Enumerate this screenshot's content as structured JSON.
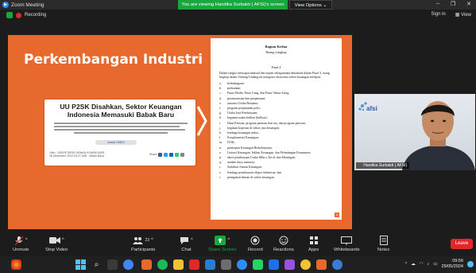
{
  "window": {
    "title": "Zoom Meeting",
    "share_banner": "You are viewing Handika Surbakti ( AFSI)'s screen",
    "view_options": "View Options"
  },
  "header": {
    "recording": "Recording",
    "sign_in": "Sign in",
    "view": "View"
  },
  "slide": {
    "title": "Perkembangan Industri",
    "article": {
      "title_line1": "UU P2SK Disahkan, Sektor Keuangan",
      "title_line2": "Indonesia Memasuki Babak Baru",
      "author_pill": "Sekdir DSBSI",
      "meta_line1": "Oleh : SEKRETARIS DEWAN KOMISIONER",
      "meta_line2": "28 Desember 2022 15:27 WIB · Waktu Baca",
      "share_label": "Share"
    },
    "document": {
      "heading": "Bagian Kedua",
      "subheading": "Ruang Lingkup",
      "article": "Pasal 4",
      "intro": "Dalam rangka mencapai maksud dan tujuan sebagaimana dimaksud dalam Pasal 3, ruang lingkup dalam Undang-Undang ini mengatur ekosistem sektor keuangan meliputi:",
      "items": [
        {
          "l": "a.",
          "t": "kelembagaan;"
        },
        {
          "l": "b.",
          "t": "perbankan;"
        },
        {
          "l": "c.",
          "t": "Pasar Modal, Pasar Uang, dan Pasar Valuta Asing;"
        },
        {
          "l": "d.",
          "t": "perasuransian dan penjaminan;"
        },
        {
          "l": "e.",
          "t": "asuransi Usaha Bersama;"
        },
        {
          "l": "f.",
          "t": "program penjaminan polis;"
        },
        {
          "l": "g.",
          "t": "Usaha Jasa Pembiayaan;"
        },
        {
          "l": "h.",
          "t": "kegiatan usaha bullion (bullion);"
        },
        {
          "l": "i.",
          "t": "Dana Pensiun, program jaminan hari tua, dan program pensiun;"
        },
        {
          "l": "j.",
          "t": "kegiatan koperasi di sektor jasa keuangan;"
        },
        {
          "l": "k.",
          "t": "lembaga keuangan mikro;"
        },
        {
          "l": "l.",
          "t": "Konglomerasi Keuangan;"
        },
        {
          "l": "m.",
          "t": "ITSK;"
        },
        {
          "l": "n.",
          "t": "penerapan Keuangan Berkelanjutan;"
        },
        {
          "l": "o.",
          "t": "Literasi Keuangan, Inklusi Keuangan, dan Pelindungan Konsumen;"
        },
        {
          "l": "p.",
          "t": "akses pembiayaan Usaha Mikro, Kecil, dan Menengah;"
        },
        {
          "l": "q.",
          "t": "sumber daya manusia;"
        },
        {
          "l": "r.",
          "t": "Stabilitas Sistem Keuangan;"
        },
        {
          "l": "s.",
          "t": "lembaga pembiayaan ekspor Indonesia; dan"
        },
        {
          "l": "t.",
          "t": "penegakan hukum di sektor keuangan."
        }
      ],
      "page_number": "3"
    }
  },
  "video": {
    "participant_name": "Handika Surbakti ( AFSI)",
    "logo_text": "afsi"
  },
  "toolbar": {
    "unmute": "Unmute",
    "stop_video": "Stop Video",
    "participants": "Participants",
    "participants_count": "23",
    "chat": "Chat",
    "share_screen": "Share Screen",
    "record": "Record",
    "reactions": "Reactions",
    "apps": "Apps",
    "whiteboards": "Whiteboards",
    "notes": "Notes",
    "leave": "Leave"
  },
  "taskbar": {
    "time": "09:56",
    "date": "29/05/2024",
    "tray_icons": [
      "chevron-up-icon",
      "cloud-icon",
      "wifi-icon",
      "speaker-icon",
      "battery-icon"
    ]
  },
  "colors": {
    "slide_bg": "#e8692e",
    "share_green": "#18a83f",
    "leave_red": "#e02828",
    "zoom_blue": "#2d8cff"
  }
}
